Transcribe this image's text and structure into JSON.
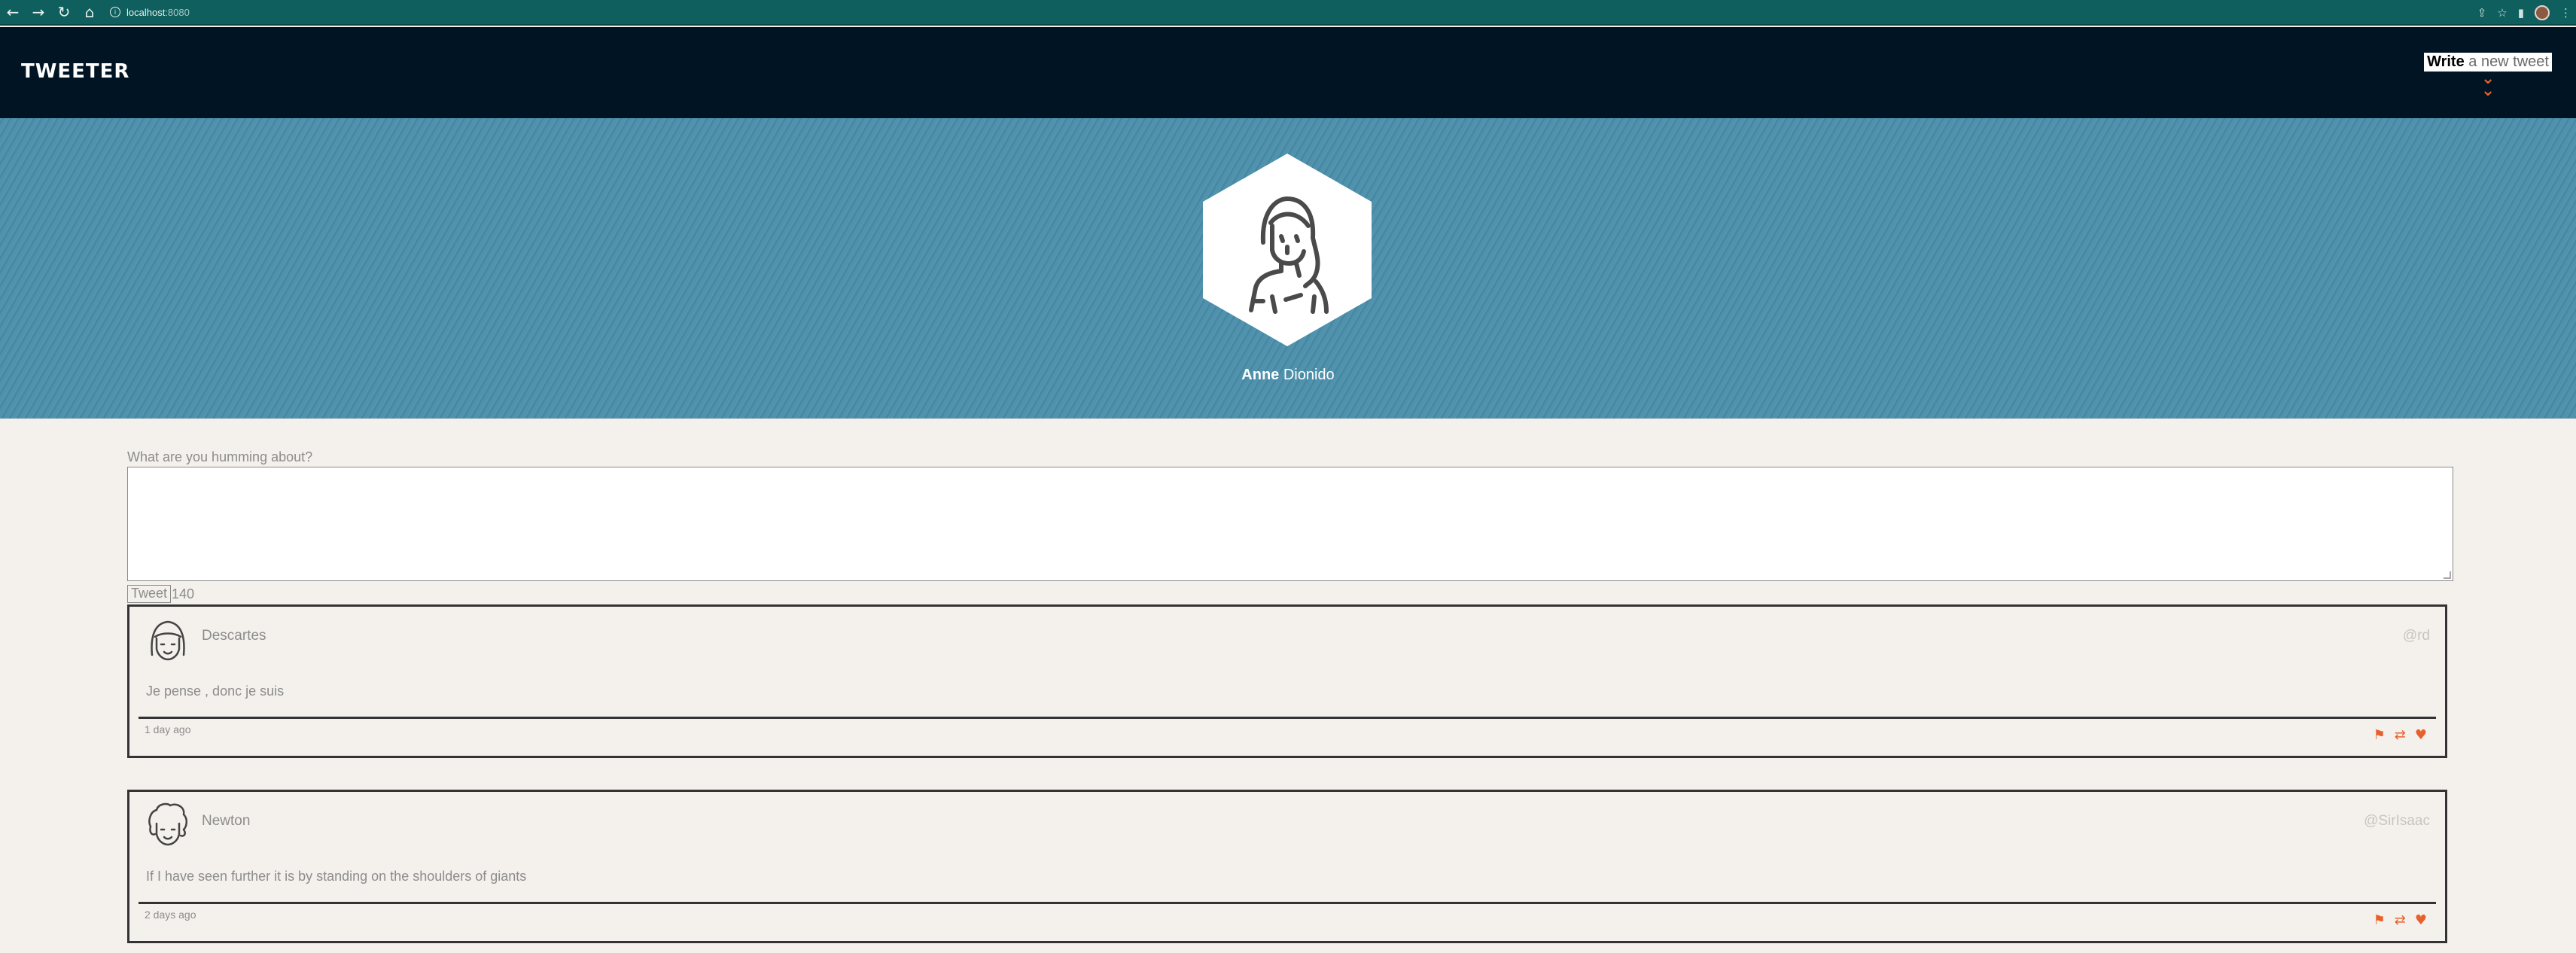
{
  "browser": {
    "url_host": "localhost",
    "url_port": ":8080"
  },
  "header": {
    "logo": "TWEETER",
    "compose_bold": "Write",
    "compose_rest": " a new tweet"
  },
  "profile": {
    "first_name": "Anne",
    "last_name": " Dionido"
  },
  "composer": {
    "label": "What are you humming about?",
    "value": "",
    "button_label": "Tweet",
    "counter": "140"
  },
  "tweets": [
    {
      "name": "Descartes",
      "handle": "@rd",
      "text": "Je pense , donc je suis",
      "time": "1 day ago"
    },
    {
      "name": "Newton",
      "handle": "@SirIsaac",
      "text": "If I have seen further it is by standing on the shoulders of giants",
      "time": "2 days ago"
    }
  ],
  "icons": {
    "flag": "flag-icon",
    "retweet": "retweet-icon",
    "like": "heart-icon"
  },
  "colors": {
    "header_bg": "#001423",
    "banner_bg": "#4a8eaa",
    "accent": "#e8602c",
    "page_bg": "#f4f1ec"
  }
}
